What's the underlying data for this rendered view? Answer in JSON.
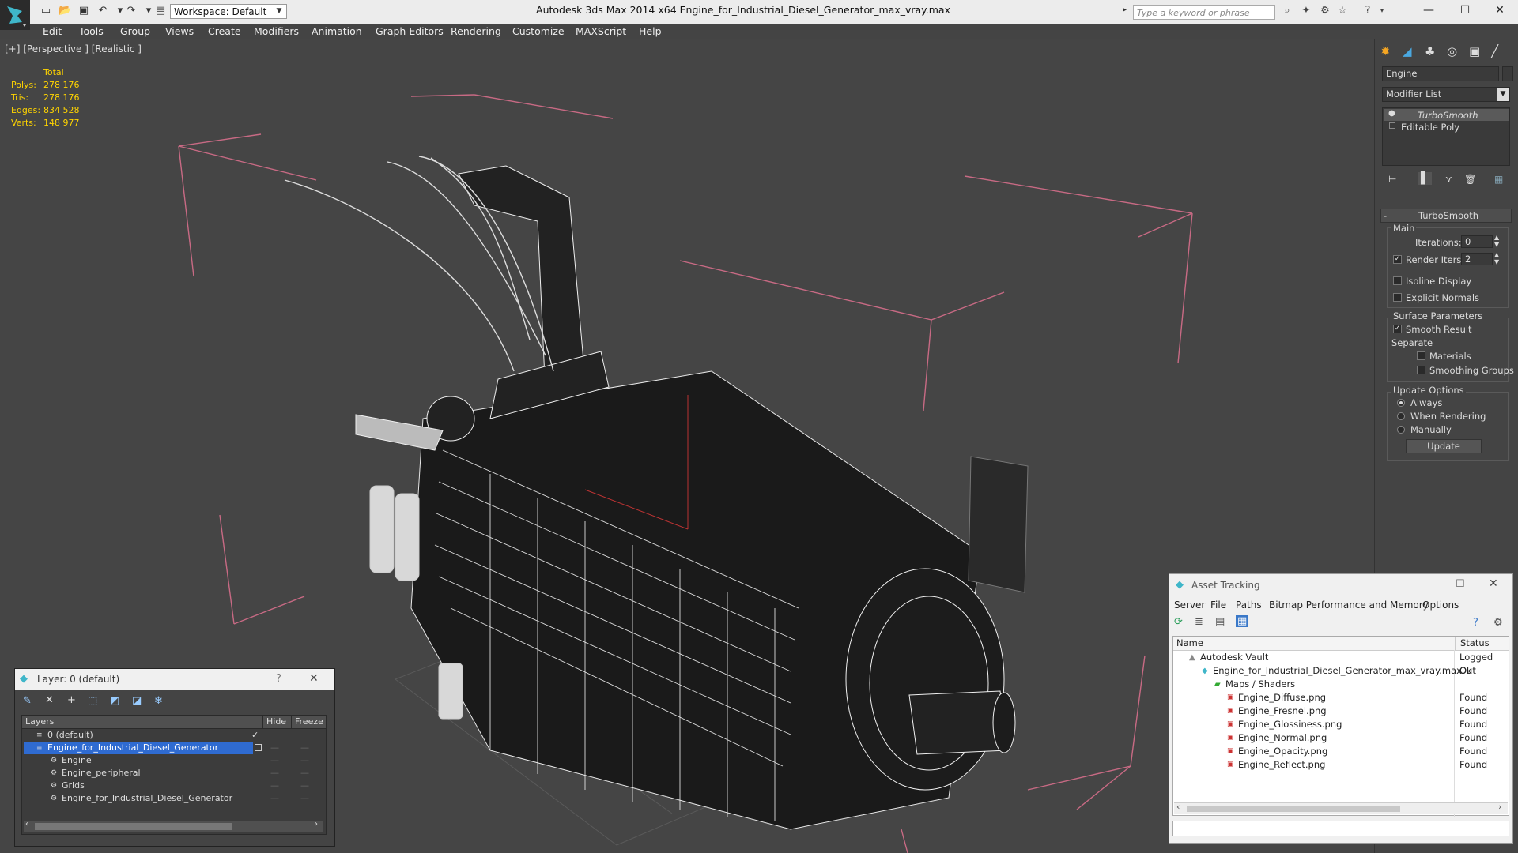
{
  "app_title": "Autodesk 3ds Max  2014 x64      Engine_for_Industrial_Diesel_Generator_max_vray.max",
  "workspace": "Workspace: Default",
  "search_placeholder": "Type a keyword or phrase",
  "menu": [
    "Edit",
    "Tools",
    "Group",
    "Views",
    "Create",
    "Modifiers",
    "Animation",
    "Graph Editors",
    "Rendering",
    "Customize",
    "MAXScript",
    "Help"
  ],
  "viewport": {
    "label": "[+] [Perspective ] [Realistic ]",
    "stats": {
      "header": "Total",
      "rows": [
        {
          "k": "Polys:",
          "v": "278 176"
        },
        {
          "k": "Tris:",
          "v": "278 176"
        },
        {
          "k": "Edges:",
          "v": "834 528"
        },
        {
          "k": "Verts:",
          "v": "148 977"
        }
      ]
    }
  },
  "command_panel": {
    "object_name": "Engine",
    "modifier_list": "Modifier List",
    "stack": [
      "TurboSmooth",
      "Editable Poly"
    ],
    "rollout_title": "TurboSmooth",
    "main": "Main",
    "iterations_label": "Iterations:",
    "iterations_value": "0",
    "render_iters_label": "Render Iters:",
    "render_iters_value": "2",
    "isoline": "Isoline Display",
    "explicit_normals": "Explicit Normals",
    "surface_params": "Surface Parameters",
    "smooth_result": "Smooth Result",
    "separate": "Separate",
    "materials": "Materials",
    "smoothing_groups": "Smoothing Groups",
    "update_options": "Update Options",
    "always": "Always",
    "when_rendering": "When Rendering",
    "manually": "Manually",
    "update_btn": "Update"
  },
  "layer_dialog": {
    "title": "Layer: 0 (default)",
    "help": "?",
    "columns": [
      "Layers",
      "Hide",
      "Freeze"
    ],
    "rows": [
      {
        "name": "0 (default)"
      },
      {
        "name": "Engine_for_Industrial_Diesel_Generator"
      },
      {
        "name": "Engine"
      },
      {
        "name": "Engine_peripheral"
      },
      {
        "name": "Grids"
      },
      {
        "name": "Engine_for_Industrial_Diesel_Generator"
      }
    ]
  },
  "asset_tracking": {
    "title": "Asset Tracking",
    "menu": [
      "Server",
      "File",
      "Paths",
      "Bitmap Performance and Memory",
      "Options"
    ],
    "columns": [
      "Name",
      "Status"
    ],
    "rows": [
      {
        "name": "Autodesk Vault",
        "status": "Logged Out"
      },
      {
        "name": "Engine_for_Industrial_Diesel_Generator_max_vray.max",
        "status": "Ok"
      },
      {
        "name": "Maps / Shaders",
        "status": ""
      },
      {
        "name": "Engine_Diffuse.png",
        "status": "Found"
      },
      {
        "name": "Engine_Fresnel.png",
        "status": "Found"
      },
      {
        "name": "Engine_Glossiness.png",
        "status": "Found"
      },
      {
        "name": "Engine_Normal.png",
        "status": "Found"
      },
      {
        "name": "Engine_Opacity.png",
        "status": "Found"
      },
      {
        "name": "Engine_Reflect.png",
        "status": "Found"
      }
    ]
  }
}
